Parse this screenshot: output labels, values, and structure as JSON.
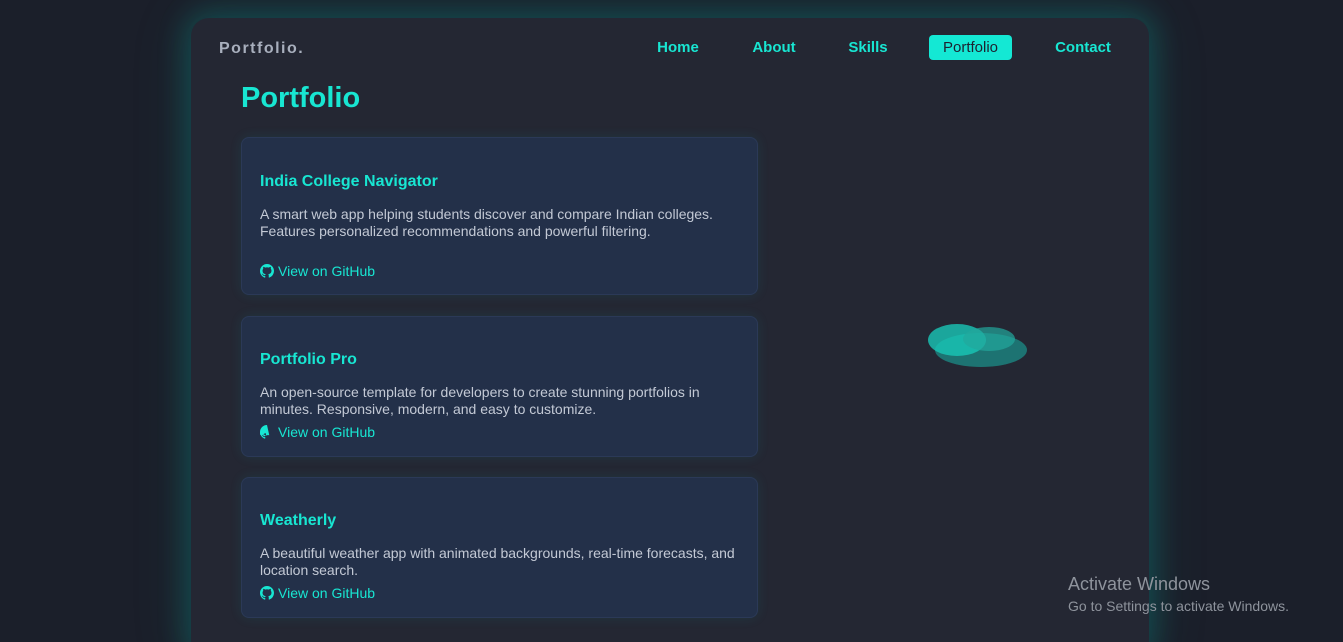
{
  "brand": "Portfolio.",
  "nav": {
    "items": [
      {
        "label": "Home",
        "active": false
      },
      {
        "label": "About",
        "active": false
      },
      {
        "label": "Skills",
        "active": false
      },
      {
        "label": "Portfolio",
        "active": true
      },
      {
        "label": "Contact",
        "active": false
      }
    ]
  },
  "main": {
    "title": "Portfolio",
    "projects": [
      {
        "title": "India College Navigator",
        "description": "A smart web app helping students discover and compare Indian colleges. Features personalized recommendations and powerful filtering.",
        "link_label": "View on GitHub",
        "link_icon": "github-icon"
      },
      {
        "title": "Portfolio Pro",
        "description": "An open-source template for developers to create stunning portfolios in minutes. Responsive, modern, and easy to customize.",
        "link_label": "View on GitHub",
        "link_icon": "github-icon"
      },
      {
        "title": "Weatherly",
        "description": "A beautiful weather app with animated backgrounds, real-time forecasts, and location search.",
        "link_label": "View on GitHub",
        "link_icon": "github-icon"
      }
    ]
  },
  "watermark": {
    "title": "Activate Windows",
    "subtitle": "Go to Settings to activate Windows."
  },
  "colors": {
    "accent": "#18e6d2",
    "background": "#1b1f2a",
    "panel": "#242733",
    "card": "#233049"
  }
}
